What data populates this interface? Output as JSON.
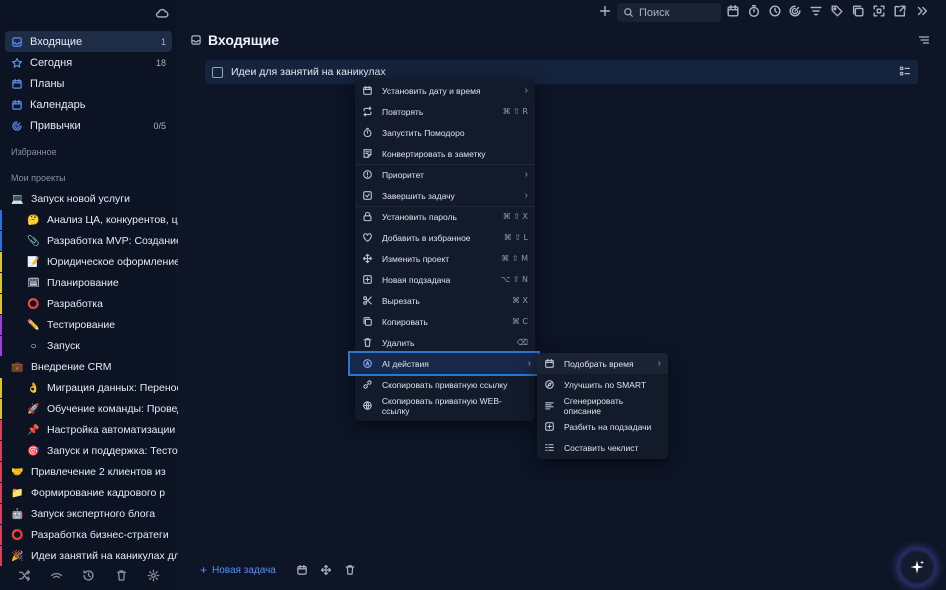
{
  "sidebar": {
    "nav": [
      {
        "label": "Входящие",
        "count": "1",
        "icon": "inbox-icon"
      },
      {
        "label": "Сегодня",
        "count": "18",
        "icon": "star-icon"
      },
      {
        "label": "Планы",
        "count": "",
        "icon": "calendar-icon"
      },
      {
        "label": "Календарь",
        "count": "",
        "icon": "calendar-icon"
      },
      {
        "label": "Привычки",
        "count": "0/5",
        "icon": "habit-icon"
      }
    ],
    "favorites_label": "Избранное",
    "projects_label": "Мои проекты",
    "projects": [
      {
        "label": "Запуск новой услуги",
        "emoji": "💻",
        "level": 0,
        "bar": ""
      },
      {
        "label": "Анализ ЦА, конкурентов, цен",
        "emoji": "🤔",
        "level": 1,
        "bar": "#2f6fd8"
      },
      {
        "label": "Разработка MVP: Создание",
        "emoji": "📎",
        "level": 1,
        "bar": "#2f6fd8"
      },
      {
        "label": "Юридическое оформление",
        "emoji": "📝",
        "level": 1,
        "bar": "#d8c72f"
      },
      {
        "label": "Планирование",
        "emoji": "🗓",
        "level": 1,
        "bar": "#d8c72f"
      },
      {
        "label": "Разработка",
        "emoji": "⭕",
        "level": 1,
        "bar": "#d8c72f"
      },
      {
        "label": "Тестирование",
        "emoji": "✏️",
        "level": 1,
        "bar": "#9b3fd8"
      },
      {
        "label": "Запуск",
        "emoji": "○",
        "level": 1,
        "bar": "#9b3fd8"
      },
      {
        "label": "Внедрение CRM",
        "emoji": "💼",
        "level": 0,
        "bar": ""
      },
      {
        "label": "Миграция данных: Перенос",
        "emoji": "👌",
        "level": 1,
        "bar": "#d8c72f"
      },
      {
        "label": "Обучение команды: Провед",
        "emoji": "🚀",
        "level": 1,
        "bar": "#d8c72f"
      },
      {
        "label": "Настройка автоматизации",
        "emoji": "📌",
        "level": 1,
        "bar": "#d83f5a"
      },
      {
        "label": "Запуск и поддержка: Тестов",
        "emoji": "🎯",
        "level": 1,
        "bar": "#d83f5a"
      },
      {
        "label": "Привлечение 2 клиентов из",
        "emoji": "🤝",
        "level": 0,
        "bar": "#d83f5a"
      },
      {
        "label": "Формирование кадрового р",
        "emoji": "📁",
        "level": 0,
        "bar": "#d83f5a"
      },
      {
        "label": "Запуск экспертного блога",
        "emoji": "🤖",
        "level": 0,
        "bar": "#d83f5a"
      },
      {
        "label": "Разработка бизнес-стратеги",
        "emoji": "⭕",
        "level": 0,
        "bar": "#d83f5a"
      },
      {
        "label": "Идеи занятий на каникулах для",
        "emoji": "🎉",
        "level": 0,
        "bar": "#d83f5a"
      }
    ]
  },
  "topbar": {
    "search_placeholder": "Поиск"
  },
  "main": {
    "title": "Входящие",
    "task": {
      "title": "Идеи для занятий на каникулах"
    }
  },
  "menu": {
    "items": [
      {
        "label": "Установить дату и время",
        "shortcut": "",
        "submenu": true,
        "icon": "calendar-icon"
      },
      {
        "label": "Повторять",
        "shortcut": "⌘ ⇧ R",
        "submenu": false,
        "icon": "repeat-icon"
      },
      {
        "label": "Запустить Помодоро",
        "shortcut": "",
        "submenu": false,
        "icon": "timer-icon"
      },
      {
        "label": "Конвертировать в заметку",
        "shortcut": "",
        "submenu": false,
        "icon": "note-icon"
      },
      {
        "label": "Приоритет",
        "shortcut": "",
        "submenu": true,
        "icon": "priority-icon"
      },
      {
        "label": "Завершить задачу",
        "shortcut": "",
        "submenu": true,
        "icon": "check-square-icon"
      },
      {
        "label": "Установить пароль",
        "shortcut": "⌘ ⇧ X",
        "submenu": false,
        "icon": "lock-icon"
      },
      {
        "label": "Добавить в избранное",
        "shortcut": "⌘ ⇧ L",
        "submenu": false,
        "icon": "heart-icon"
      },
      {
        "label": "Изменить проект",
        "shortcut": "⌘ ⇧ M",
        "submenu": false,
        "icon": "move-icon"
      },
      {
        "label": "Новая подзадача",
        "shortcut": "⌥ ⇧ N",
        "submenu": false,
        "icon": "plus-square-icon"
      },
      {
        "label": "Вырезать",
        "shortcut": "⌘ X",
        "submenu": false,
        "icon": "scissors-icon"
      },
      {
        "label": "Копировать",
        "shortcut": "⌘ C",
        "submenu": false,
        "icon": "copy-icon"
      },
      {
        "label": "Удалить",
        "shortcut": "⌫",
        "submenu": false,
        "icon": "trash-icon"
      },
      {
        "label": "AI действия",
        "shortcut": "",
        "submenu": true,
        "icon": "ai-icon"
      },
      {
        "label": "Скопировать приватную ссылку",
        "shortcut": "",
        "submenu": false,
        "icon": "link-icon"
      },
      {
        "label": "Скопировать приватную WEB-ссылку",
        "shortcut": "",
        "submenu": false,
        "icon": "globe-icon"
      }
    ]
  },
  "submenu": {
    "items": [
      {
        "label": "Подобрать время",
        "submenu": true,
        "icon": "calendar-icon"
      },
      {
        "label": "Улучшить по SMART",
        "submenu": false,
        "icon": "compass-icon"
      },
      {
        "label": "Сгенерировать описание",
        "submenu": false,
        "icon": "text-icon"
      },
      {
        "label": "Разбить на подзадачи",
        "submenu": false,
        "icon": "plus-square-icon"
      },
      {
        "label": "Составить чеклист",
        "submenu": false,
        "icon": "checklist-icon"
      }
    ]
  },
  "bottom": {
    "new_task": "Новая задача"
  },
  "colors": {
    "accent": "#2d74d4",
    "background": "#0d1526",
    "sidebar": "#0c1322"
  }
}
